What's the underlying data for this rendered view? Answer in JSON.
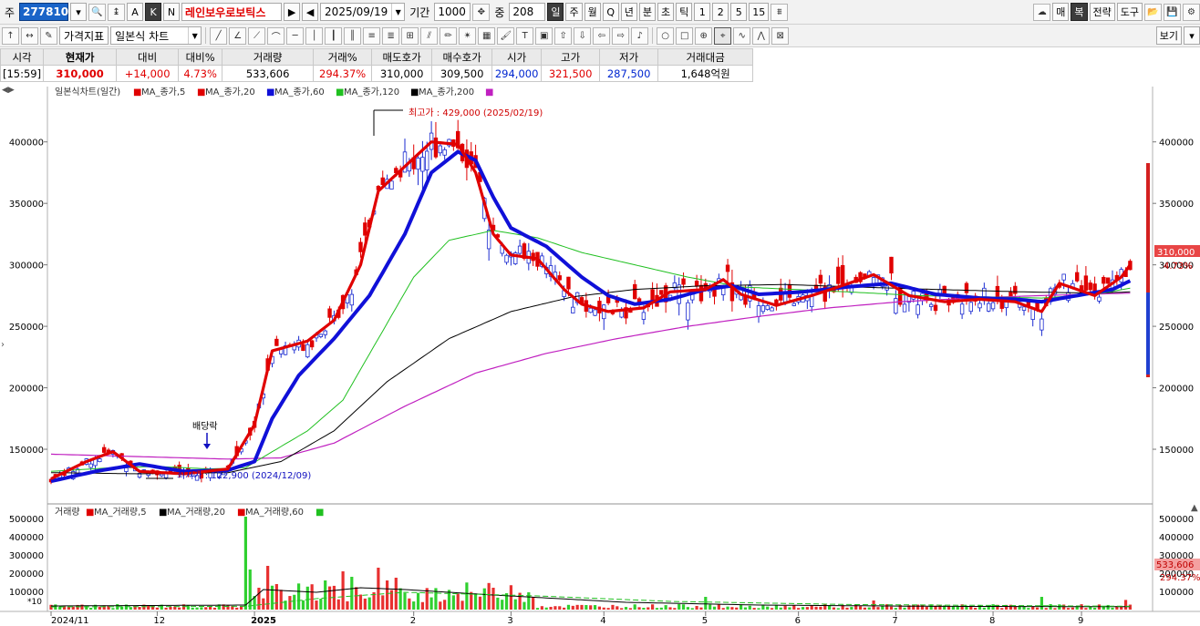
{
  "toolbar": {
    "market_label": "주",
    "stock_code": "277810",
    "toggles": [
      "A",
      "K",
      "N"
    ],
    "stock_name": "레인보우로보틱스",
    "date": "2025/09/19",
    "period_label": "기간",
    "period_value": "1000",
    "count_label": "중",
    "count_value": "208",
    "intervals": [
      "일",
      "주",
      "월",
      "Q",
      "년",
      "분",
      "초",
      "틱",
      "1",
      "2",
      "5",
      "15"
    ],
    "right_buttons": [
      "매",
      "복",
      "전략",
      "도구"
    ],
    "indicator_label": "가격지표",
    "chart_type": "일본식 차트",
    "view_label": "보기"
  },
  "quote": {
    "headers": [
      "시각",
      "현재가",
      "대비",
      "대비%",
      "거래량",
      "거래%",
      "매도호가",
      "매수호가",
      "시가",
      "고가",
      "저가",
      "거래대금"
    ],
    "values": [
      "[15:59]",
      "310,000",
      "+14,000",
      "4.73%",
      "533,606",
      "294.37%",
      "310,000",
      "309,500",
      "294,000",
      "321,500",
      "287,500",
      "1,648억원"
    ]
  },
  "chart_legend": {
    "title": "일본식차트(일간)",
    "ma": [
      "MA_종가,5",
      "MA_종가,20",
      "MA_종가,60",
      "MA_종가,120",
      "MA_종가,200"
    ],
    "ma_colors": [
      "#e00000",
      "#e00000",
      "#1010d8",
      "#20c020",
      "#000000",
      "#c020c0"
    ]
  },
  "volume_legend": {
    "title": "거래량",
    "ma": [
      "MA_거래량,5",
      "MA_거래량,20",
      "MA_거래량,60"
    ],
    "ma_colors": [
      "#e00000",
      "#000000",
      "#e00000",
      "#20c020"
    ],
    "multiplier": "*10"
  },
  "annotations": {
    "high": "최고가 : 429,000 (2025/02/19)",
    "low": "최저가 : 122,900 (2024/12/09)",
    "dividend": "배당락"
  },
  "price_tag": {
    "price": "310,000",
    "pct": "4.73%"
  },
  "volume_tag": {
    "value": "533,606",
    "pct": "294.37%"
  },
  "chart_data": {
    "type": "candlestick",
    "title": "일본식차트(일간)",
    "y_ticks": [
      150000,
      200000,
      250000,
      300000,
      350000,
      400000
    ],
    "y_range": [
      110000,
      445000
    ],
    "volume_ticks": [
      100000,
      200000,
      300000,
      400000,
      500000
    ],
    "volume_range": [
      0,
      560000
    ],
    "x_labels": [
      "2024/11",
      "12",
      "2025",
      "2",
      "3",
      "4",
      "5",
      "6",
      "7",
      "8",
      "9"
    ],
    "x_label_days": [
      0,
      24,
      46,
      82,
      104,
      125,
      148,
      169,
      191,
      213,
      233
    ],
    "ma_anchors": {
      "ma5": [
        [
          0,
          126000
        ],
        [
          8,
          140000
        ],
        [
          14,
          148000
        ],
        [
          20,
          132000
        ],
        [
          30,
          130000
        ],
        [
          40,
          134000
        ],
        [
          46,
          170000
        ],
        [
          50,
          230000
        ],
        [
          58,
          238000
        ],
        [
          64,
          255000
        ],
        [
          70,
          300000
        ],
        [
          74,
          360000
        ],
        [
          80,
          380000
        ],
        [
          86,
          400000
        ],
        [
          92,
          398000
        ],
        [
          96,
          375000
        ],
        [
          100,
          325000
        ],
        [
          104,
          308000
        ],
        [
          110,
          305000
        ],
        [
          116,
          280000
        ],
        [
          120,
          268000
        ],
        [
          126,
          262000
        ],
        [
          134,
          265000
        ],
        [
          140,
          278000
        ],
        [
          148,
          280000
        ],
        [
          152,
          288000
        ],
        [
          156,
          276000
        ],
        [
          164,
          267000
        ],
        [
          172,
          275000
        ],
        [
          178,
          282000
        ],
        [
          186,
          292000
        ],
        [
          194,
          275000
        ],
        [
          202,
          270000
        ],
        [
          210,
          272000
        ],
        [
          218,
          270000
        ],
        [
          224,
          262000
        ],
        [
          228,
          285000
        ],
        [
          236,
          275000
        ],
        [
          242,
          290000
        ],
        [
          244,
          300000
        ]
      ],
      "ma20": [
        [
          0,
          124000
        ],
        [
          10,
          132000
        ],
        [
          20,
          138000
        ],
        [
          30,
          132000
        ],
        [
          40,
          133000
        ],
        [
          46,
          140000
        ],
        [
          50,
          175000
        ],
        [
          56,
          210000
        ],
        [
          64,
          240000
        ],
        [
          72,
          275000
        ],
        [
          80,
          325000
        ],
        [
          86,
          375000
        ],
        [
          92,
          392000
        ],
        [
          96,
          385000
        ],
        [
          100,
          355000
        ],
        [
          104,
          330000
        ],
        [
          112,
          315000
        ],
        [
          120,
          290000
        ],
        [
          126,
          275000
        ],
        [
          132,
          268000
        ],
        [
          140,
          272000
        ],
        [
          148,
          280000
        ],
        [
          154,
          283000
        ],
        [
          160,
          276000
        ],
        [
          170,
          278000
        ],
        [
          180,
          282000
        ],
        [
          190,
          285000
        ],
        [
          200,
          276000
        ],
        [
          210,
          273000
        ],
        [
          218,
          272000
        ],
        [
          224,
          270000
        ],
        [
          232,
          275000
        ],
        [
          240,
          280000
        ],
        [
          244,
          287000
        ]
      ],
      "ma60": [
        [
          0,
          132000
        ],
        [
          14,
          135000
        ],
        [
          24,
          136000
        ],
        [
          36,
          134000
        ],
        [
          44,
          135000
        ],
        [
          50,
          148000
        ],
        [
          58,
          165000
        ],
        [
          66,
          190000
        ],
        [
          74,
          240000
        ],
        [
          82,
          290000
        ],
        [
          90,
          320000
        ],
        [
          100,
          328000
        ],
        [
          110,
          322000
        ],
        [
          120,
          310000
        ],
        [
          132,
          300000
        ],
        [
          144,
          290000
        ],
        [
          156,
          282000
        ],
        [
          168,
          280000
        ],
        [
          180,
          278000
        ],
        [
          196,
          275000
        ],
        [
          210,
          274000
        ],
        [
          224,
          273000
        ],
        [
          236,
          276000
        ],
        [
          244,
          281000
        ]
      ],
      "ma120": [
        [
          0,
          131000
        ],
        [
          20,
          130000
        ],
        [
          40,
          131000
        ],
        [
          52,
          140000
        ],
        [
          64,
          165000
        ],
        [
          76,
          205000
        ],
        [
          90,
          240000
        ],
        [
          104,
          262000
        ],
        [
          118,
          274000
        ],
        [
          132,
          280000
        ],
        [
          148,
          283000
        ],
        [
          166,
          284000
        ],
        [
          182,
          282000
        ],
        [
          200,
          280000
        ],
        [
          220,
          278000
        ],
        [
          236,
          277000
        ],
        [
          244,
          278000
        ]
      ],
      "ma200": [
        [
          0,
          146000
        ],
        [
          20,
          144000
        ],
        [
          40,
          142000
        ],
        [
          52,
          143000
        ],
        [
          64,
          155000
        ],
        [
          80,
          185000
        ],
        [
          96,
          212000
        ],
        [
          112,
          228000
        ],
        [
          128,
          240000
        ],
        [
          144,
          250000
        ],
        [
          160,
          258000
        ],
        [
          176,
          265000
        ],
        [
          192,
          270000
        ],
        [
          208,
          273000
        ],
        [
          224,
          275000
        ],
        [
          244,
          277000
        ]
      ]
    }
  }
}
